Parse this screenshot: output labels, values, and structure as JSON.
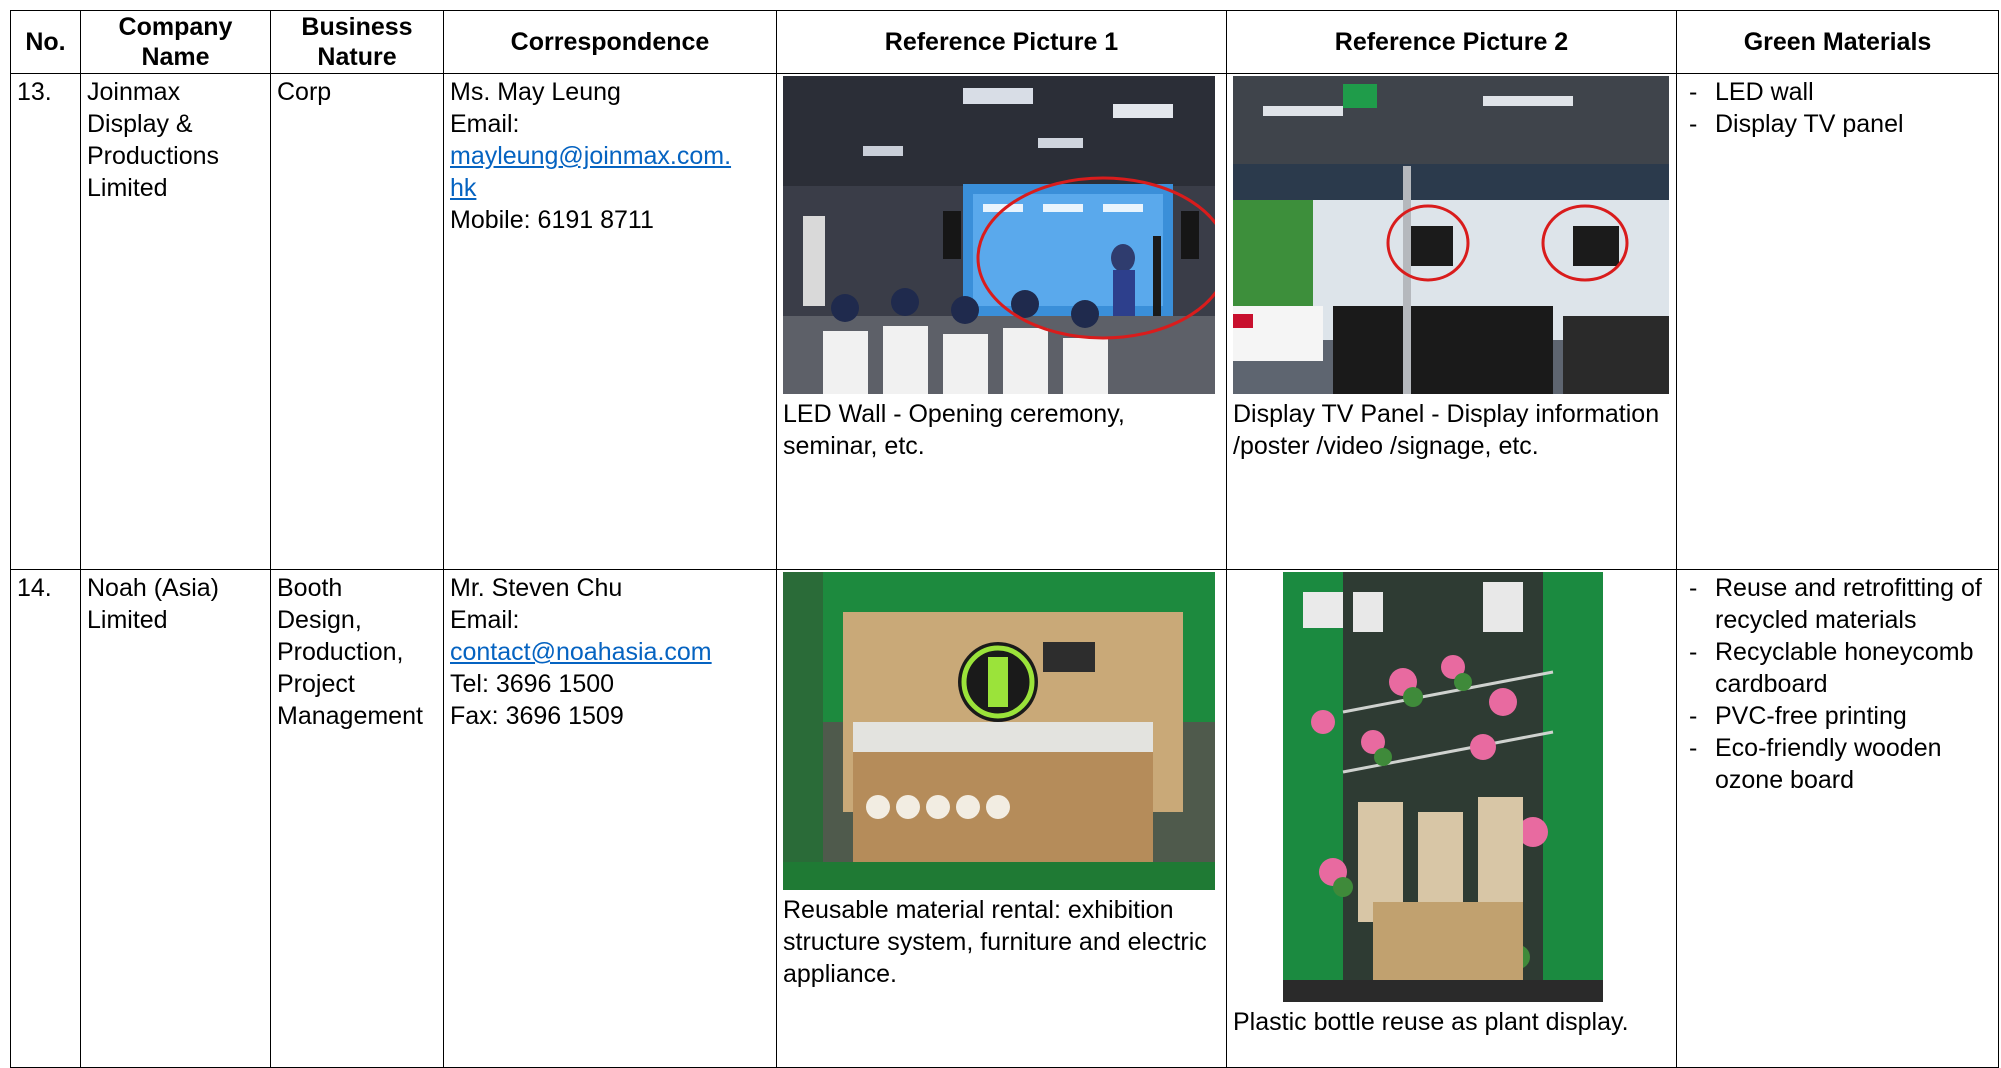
{
  "headers": {
    "no": "No.",
    "company": "Company Name",
    "business": "Business Nature",
    "correspondence": "Correspondence",
    "pic1": "Reference Picture 1",
    "pic2": "Reference Picture 2",
    "green": "Green Materials"
  },
  "rows": [
    {
      "no": "13.",
      "company": [
        "Joinmax",
        "Display &",
        "Productions",
        "Limited"
      ],
      "business": [
        "Corp"
      ],
      "contact": {
        "name": "Ms. May Leung",
        "email_label": "Email:",
        "email_lines": [
          "mayleung@joinmax.com.",
          "hk"
        ],
        "phone": "Mobile: 6191 8711"
      },
      "pic1_caption": "LED Wall - Opening ceremony, seminar, etc.",
      "pic2_caption": "Display TV Panel - Display information /poster /video /signage, etc.",
      "green": [
        "LED wall",
        "Display TV panel"
      ]
    },
    {
      "no": "14.",
      "company": [
        "Noah (Asia)",
        "Limited"
      ],
      "business": [
        "Booth",
        "Design,",
        "Production,",
        "Project",
        "Management"
      ],
      "contact": {
        "name": "Mr. Steven Chu",
        "email_label": "Email:",
        "email_lines": [
          "contact@noahasia.com"
        ],
        "phone": "Tel: 3696 1500",
        "fax": "Fax: 3696 1509"
      },
      "pic1_caption": "Reusable material rental: exhibition structure system, furniture and electric appliance.",
      "pic2_caption": "Plastic bottle reuse as plant display.",
      "green": [
        "Reuse and retrofitting of recycled materials",
        "Recyclable honeycomb cardboard",
        "PVC-free printing",
        "Eco-friendly wooden ozone board"
      ]
    }
  ]
}
